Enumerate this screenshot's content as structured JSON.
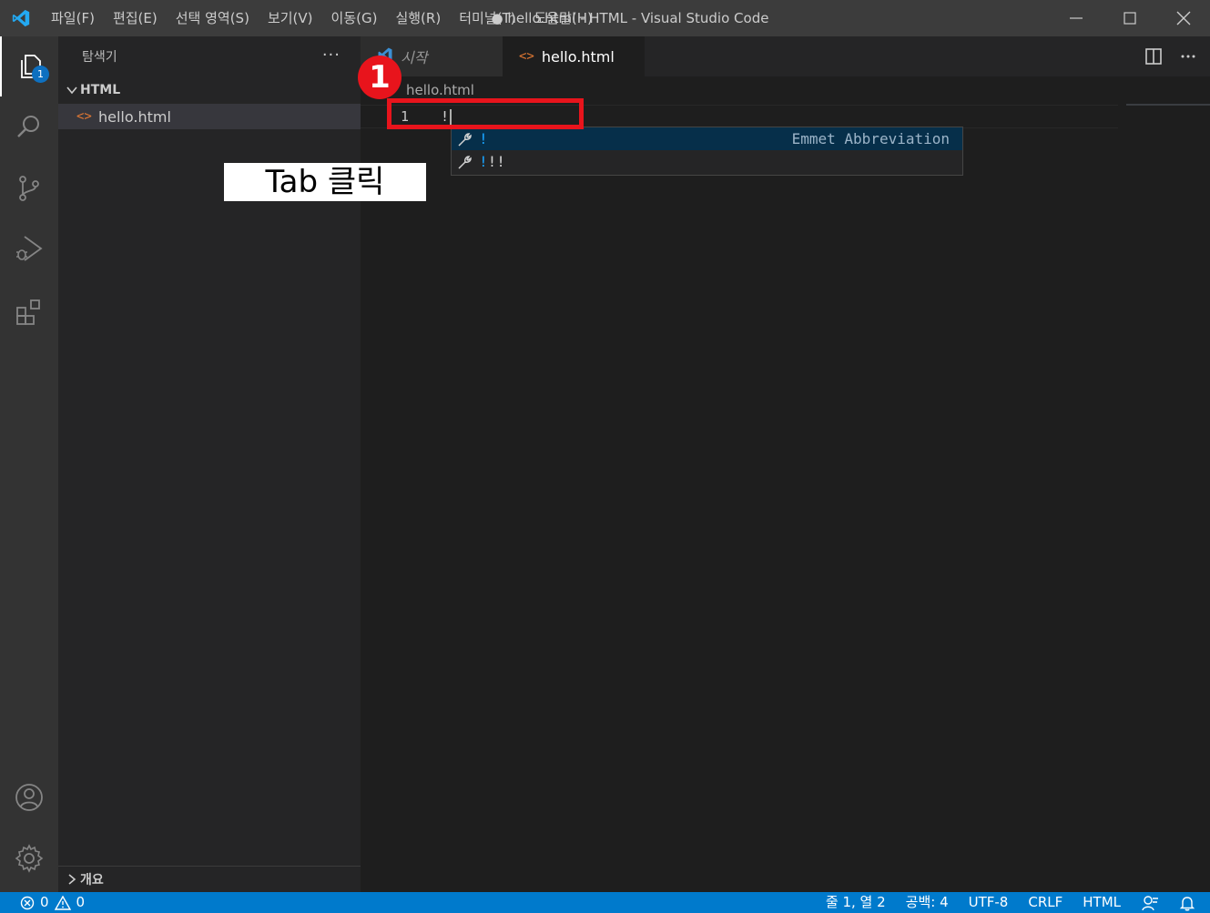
{
  "titlebar": {
    "menu": [
      "파일(F)",
      "편집(E)",
      "선택 영역(S)",
      "보기(V)",
      "이동(G)",
      "실행(R)",
      "터미널(T)",
      "도움말(H)"
    ],
    "window_title": "● hello.html - HTML - Visual Studio Code"
  },
  "activitybar": {
    "items": [
      "explorer-icon",
      "search-icon",
      "source-control-icon",
      "run-debug-icon",
      "extensions-icon"
    ],
    "explorer_badge": "1",
    "bottom": [
      "account-icon",
      "settings-gear-icon"
    ]
  },
  "sidebar": {
    "title": "탐색기",
    "more": "···",
    "section": "HTML",
    "files": [
      {
        "name": "hello.html",
        "icon": "<>"
      }
    ],
    "outline_label": "개요"
  },
  "annotation": {
    "instruction": "Tab 클릭",
    "step_number": "1"
  },
  "tabs": [
    {
      "label": "시작",
      "active": false
    },
    {
      "label": "hello.html",
      "active": true,
      "dirty": true
    }
  ],
  "breadcrumb": "hello.html",
  "editor": {
    "lines": [
      {
        "number": "1",
        "code": "!"
      }
    ]
  },
  "suggest": {
    "items": [
      {
        "label": "!",
        "rest": "",
        "detail": "Emmet Abbreviation",
        "selected": true
      },
      {
        "label": "!",
        "rest": "!!",
        "detail": "",
        "selected": false
      }
    ]
  },
  "statusbar": {
    "errors": "0",
    "warnings": "0",
    "position": "줄 1, 열 2",
    "spaces": "공백: 4",
    "encoding": "UTF-8",
    "eol": "CRLF",
    "language": "HTML"
  },
  "colors": {
    "accent": "#007acc",
    "annotation_red": "#e8141c",
    "suggest_highlight": "#18a3ff"
  }
}
